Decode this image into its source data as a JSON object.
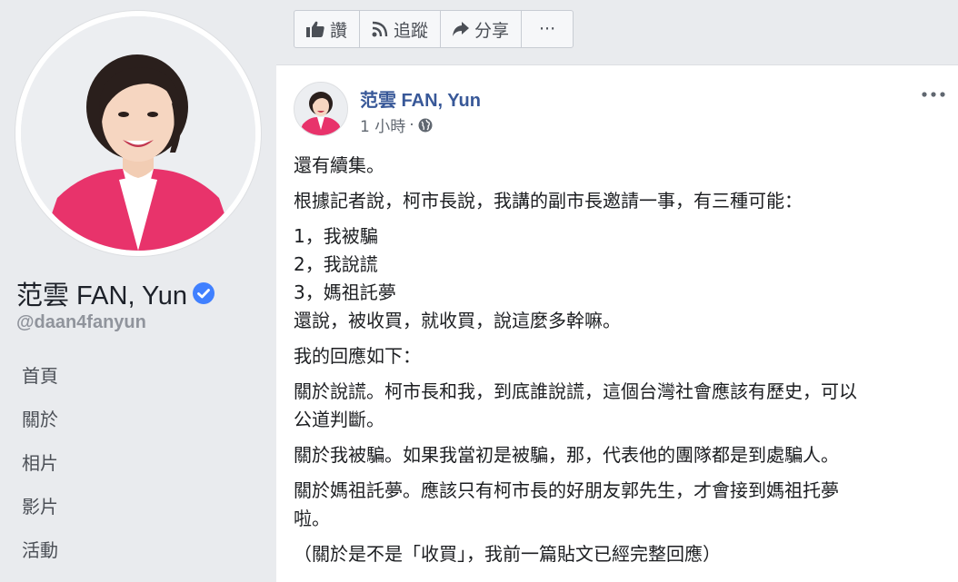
{
  "page": {
    "name": "范雲 FAN, Yun",
    "handle": "@daan4fanyun",
    "verified_icon": "verified-check-icon"
  },
  "nav": {
    "items": [
      {
        "label": "首頁"
      },
      {
        "label": "關於"
      },
      {
        "label": "相片"
      },
      {
        "label": "影片"
      },
      {
        "label": "活動"
      }
    ]
  },
  "actions": {
    "like_label": "讚",
    "follow_label": "追蹤",
    "share_label": "分享",
    "more_label": "···",
    "like_icon": "thumbs-up-icon",
    "follow_icon": "rss-icon",
    "share_icon": "share-arrow-icon"
  },
  "post": {
    "author": "范雲 FAN, Yun",
    "timestamp": "1 小時",
    "separator": "·",
    "privacy_icon": "globe-icon",
    "more_icon": "more-dots-icon",
    "paragraphs": [
      [
        "還有續集。"
      ],
      [
        "根據記者說，柯市長說，我講的副市長邀請一事，有三種可能："
      ],
      [
        "1，我被騙",
        "2，我說謊",
        "3，媽祖託夢",
        "還說，被收買，就收買，說這麼多幹嘛。"
      ],
      [
        "我的回應如下："
      ],
      [
        "關於說謊。柯市長和我，到底誰說謊，這個台灣社會應該有歷史，可以",
        "公道判斷。"
      ],
      [
        "關於我被騙。如果我當初是被騙，那，代表他的團隊都是到處騙人。"
      ],
      [
        "關於媽祖託夢。應該只有柯市長的好朋友郭先生，才會接到媽祖托夢",
        "啦。"
      ],
      [
        "（關於是不是「收買」，我前一篇貼文已經完整回應）"
      ]
    ]
  },
  "colors": {
    "background": "#e9ebee",
    "link_blue": "#385898",
    "verified_blue": "#4080ff",
    "jacket_pink": "#e8336b"
  }
}
